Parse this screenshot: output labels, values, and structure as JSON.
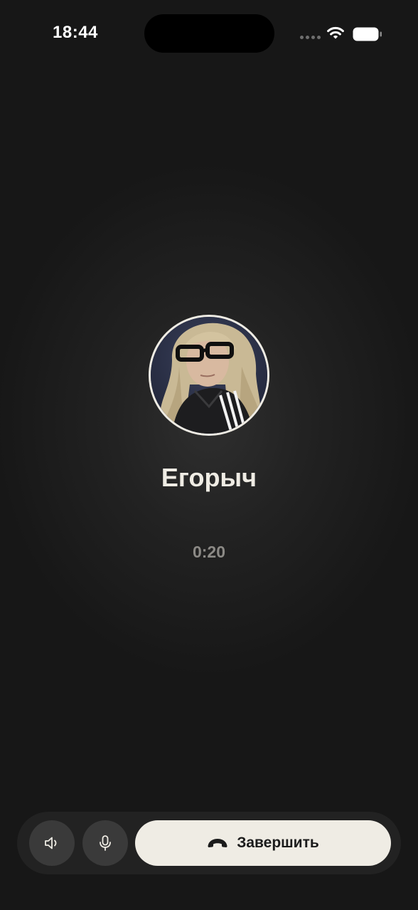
{
  "status_bar": {
    "time": "18:44",
    "icons": [
      "signal-dots",
      "wifi-icon",
      "battery-icon"
    ]
  },
  "call": {
    "contact_name": "Егорыч",
    "duration": "0:20",
    "avatar": "contact-photo"
  },
  "controls": {
    "speaker_icon": "speaker-icon",
    "mic_icon": "microphone-icon",
    "end_call_icon": "phone-hangup-icon",
    "end_call_label": "Завершить"
  },
  "colors": {
    "background": "#161616",
    "accent_light": "#efece4",
    "button_dark": "#3a3a3a",
    "bar_bg": "#222222",
    "timer_text": "#8c8a86"
  }
}
